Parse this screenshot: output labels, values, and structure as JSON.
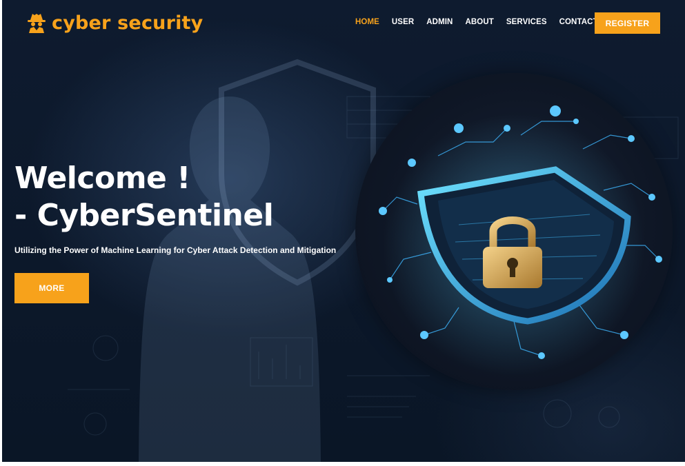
{
  "brand": {
    "name": "cyber security",
    "icon": "spy-icon",
    "color": "#f7a21b"
  },
  "nav": {
    "items": [
      {
        "label": "HOME",
        "active": true
      },
      {
        "label": "USER",
        "active": false
      },
      {
        "label": "ADMIN",
        "active": false
      },
      {
        "label": "ABOUT",
        "active": false
      },
      {
        "label": "SERVICES",
        "active": false
      },
      {
        "label": "CONTACT",
        "active": false
      }
    ],
    "register_label": "REGISTER"
  },
  "hero": {
    "title_line1": "Welcome !",
    "title_line2": "- CyberSentinel",
    "subtitle": "Utilizing the Power of Machine Learning for Cyber Attack Detection and Mitigation",
    "more_label": "MORE",
    "image": "padlock-shield-circuit-illustration"
  },
  "colors": {
    "accent": "#f7a21b",
    "background": "#0d1a2d",
    "text": "#ffffff"
  }
}
